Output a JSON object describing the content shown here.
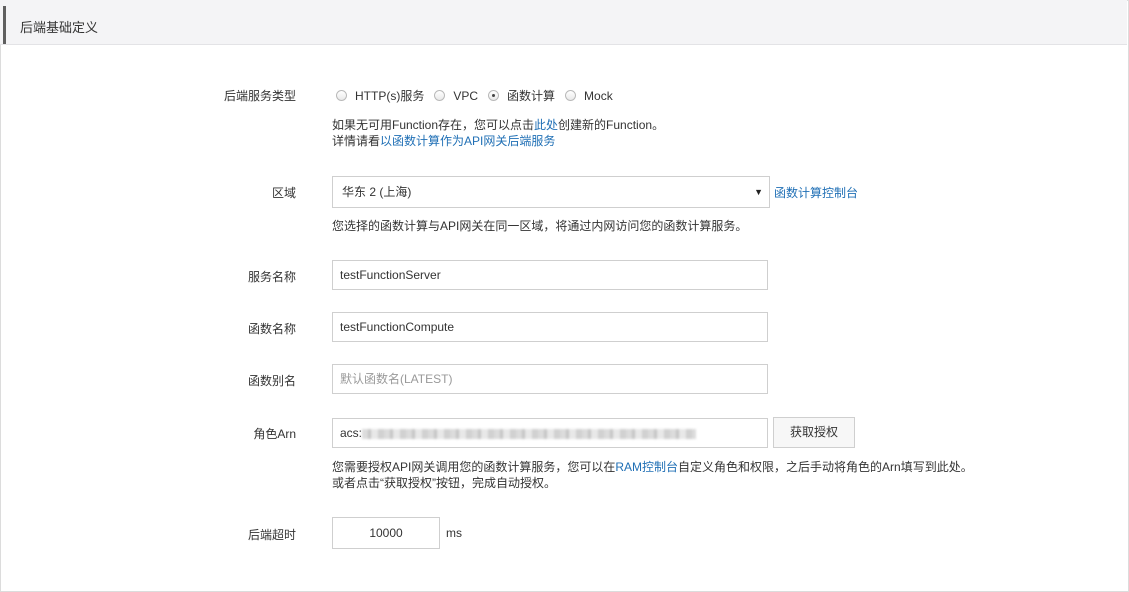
{
  "section": {
    "title": "后端基础定义"
  },
  "backend_type": {
    "label": "后端服务类型",
    "options": [
      {
        "label": "HTTP(s)服务",
        "checked": false
      },
      {
        "label": "VPC",
        "checked": false
      },
      {
        "label": "函数计算",
        "checked": true
      },
      {
        "label": "Mock",
        "checked": false
      }
    ],
    "help_line1_prefix": "如果无可用Function存在，您可以点击",
    "help_line1_link": "此处",
    "help_line1_suffix": "创建新的Function。",
    "help_line2_prefix": "详情请看",
    "help_line2_link": "以函数计算作为API网关后端服务"
  },
  "region": {
    "label": "区域",
    "selected": "华东 2 (上海)",
    "console_link": "函数计算控制台",
    "help": "您选择的函数计算与API网关在同一区域，将通过内网访问您的函数计算服务。"
  },
  "service_name": {
    "label": "服务名称",
    "value": "testFunctionServer"
  },
  "function_name": {
    "label": "函数名称",
    "value": "testFunctionCompute"
  },
  "function_alias": {
    "label": "函数别名",
    "placeholder": "默认函数名(LATEST)"
  },
  "role_arn": {
    "label": "角色Arn",
    "value_prefix": "acs:",
    "authorize_button": "获取授权",
    "help_line1_prefix": "您需要授权API网关调用您的函数计算服务，您可以在",
    "help_line1_link": "RAM控制台",
    "help_line1_suffix": "自定义角色和权限，之后手动将角色的Arn填写到此处。",
    "help_line2": "或者点击“获取授权”按钮，完成自动授权。"
  },
  "timeout": {
    "label": "后端超时",
    "value": "10000",
    "unit": "ms"
  },
  "colors": {
    "link": "#1f6fb5",
    "header_bg": "#f4f4f6",
    "accent_bar": "#5f5f5f"
  }
}
